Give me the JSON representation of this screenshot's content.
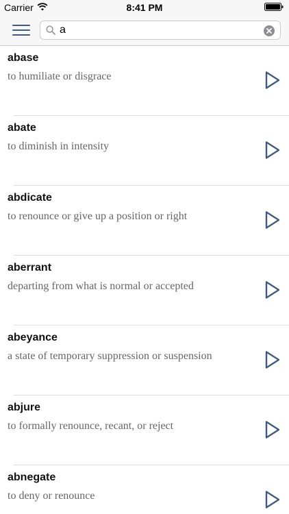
{
  "status_bar": {
    "carrier": "Carrier",
    "time": "8:41 PM"
  },
  "search": {
    "value": "a",
    "icon": "search-icon",
    "clear_icon": "clear-icon"
  },
  "menu": {
    "icon": "hamburger-menu-icon"
  },
  "colors": {
    "accent": "#3f5b85",
    "term": "#111111",
    "definition": "#666666",
    "separator": "#e0e0e0"
  },
  "words": [
    {
      "term": "abase",
      "definition": "to humiliate or disgrace"
    },
    {
      "term": "abate",
      "definition": "to diminish in intensity"
    },
    {
      "term": "abdicate",
      "definition": "to renounce or give up a position or right"
    },
    {
      "term": "aberrant",
      "definition": "departing from what is normal or accepted"
    },
    {
      "term": "abeyance",
      "definition": "a state of temporary suppression or suspension"
    },
    {
      "term": "abjure",
      "definition": "to formally renounce, recant, or reject"
    },
    {
      "term": "abnegate",
      "definition": "to deny or renounce"
    }
  ]
}
